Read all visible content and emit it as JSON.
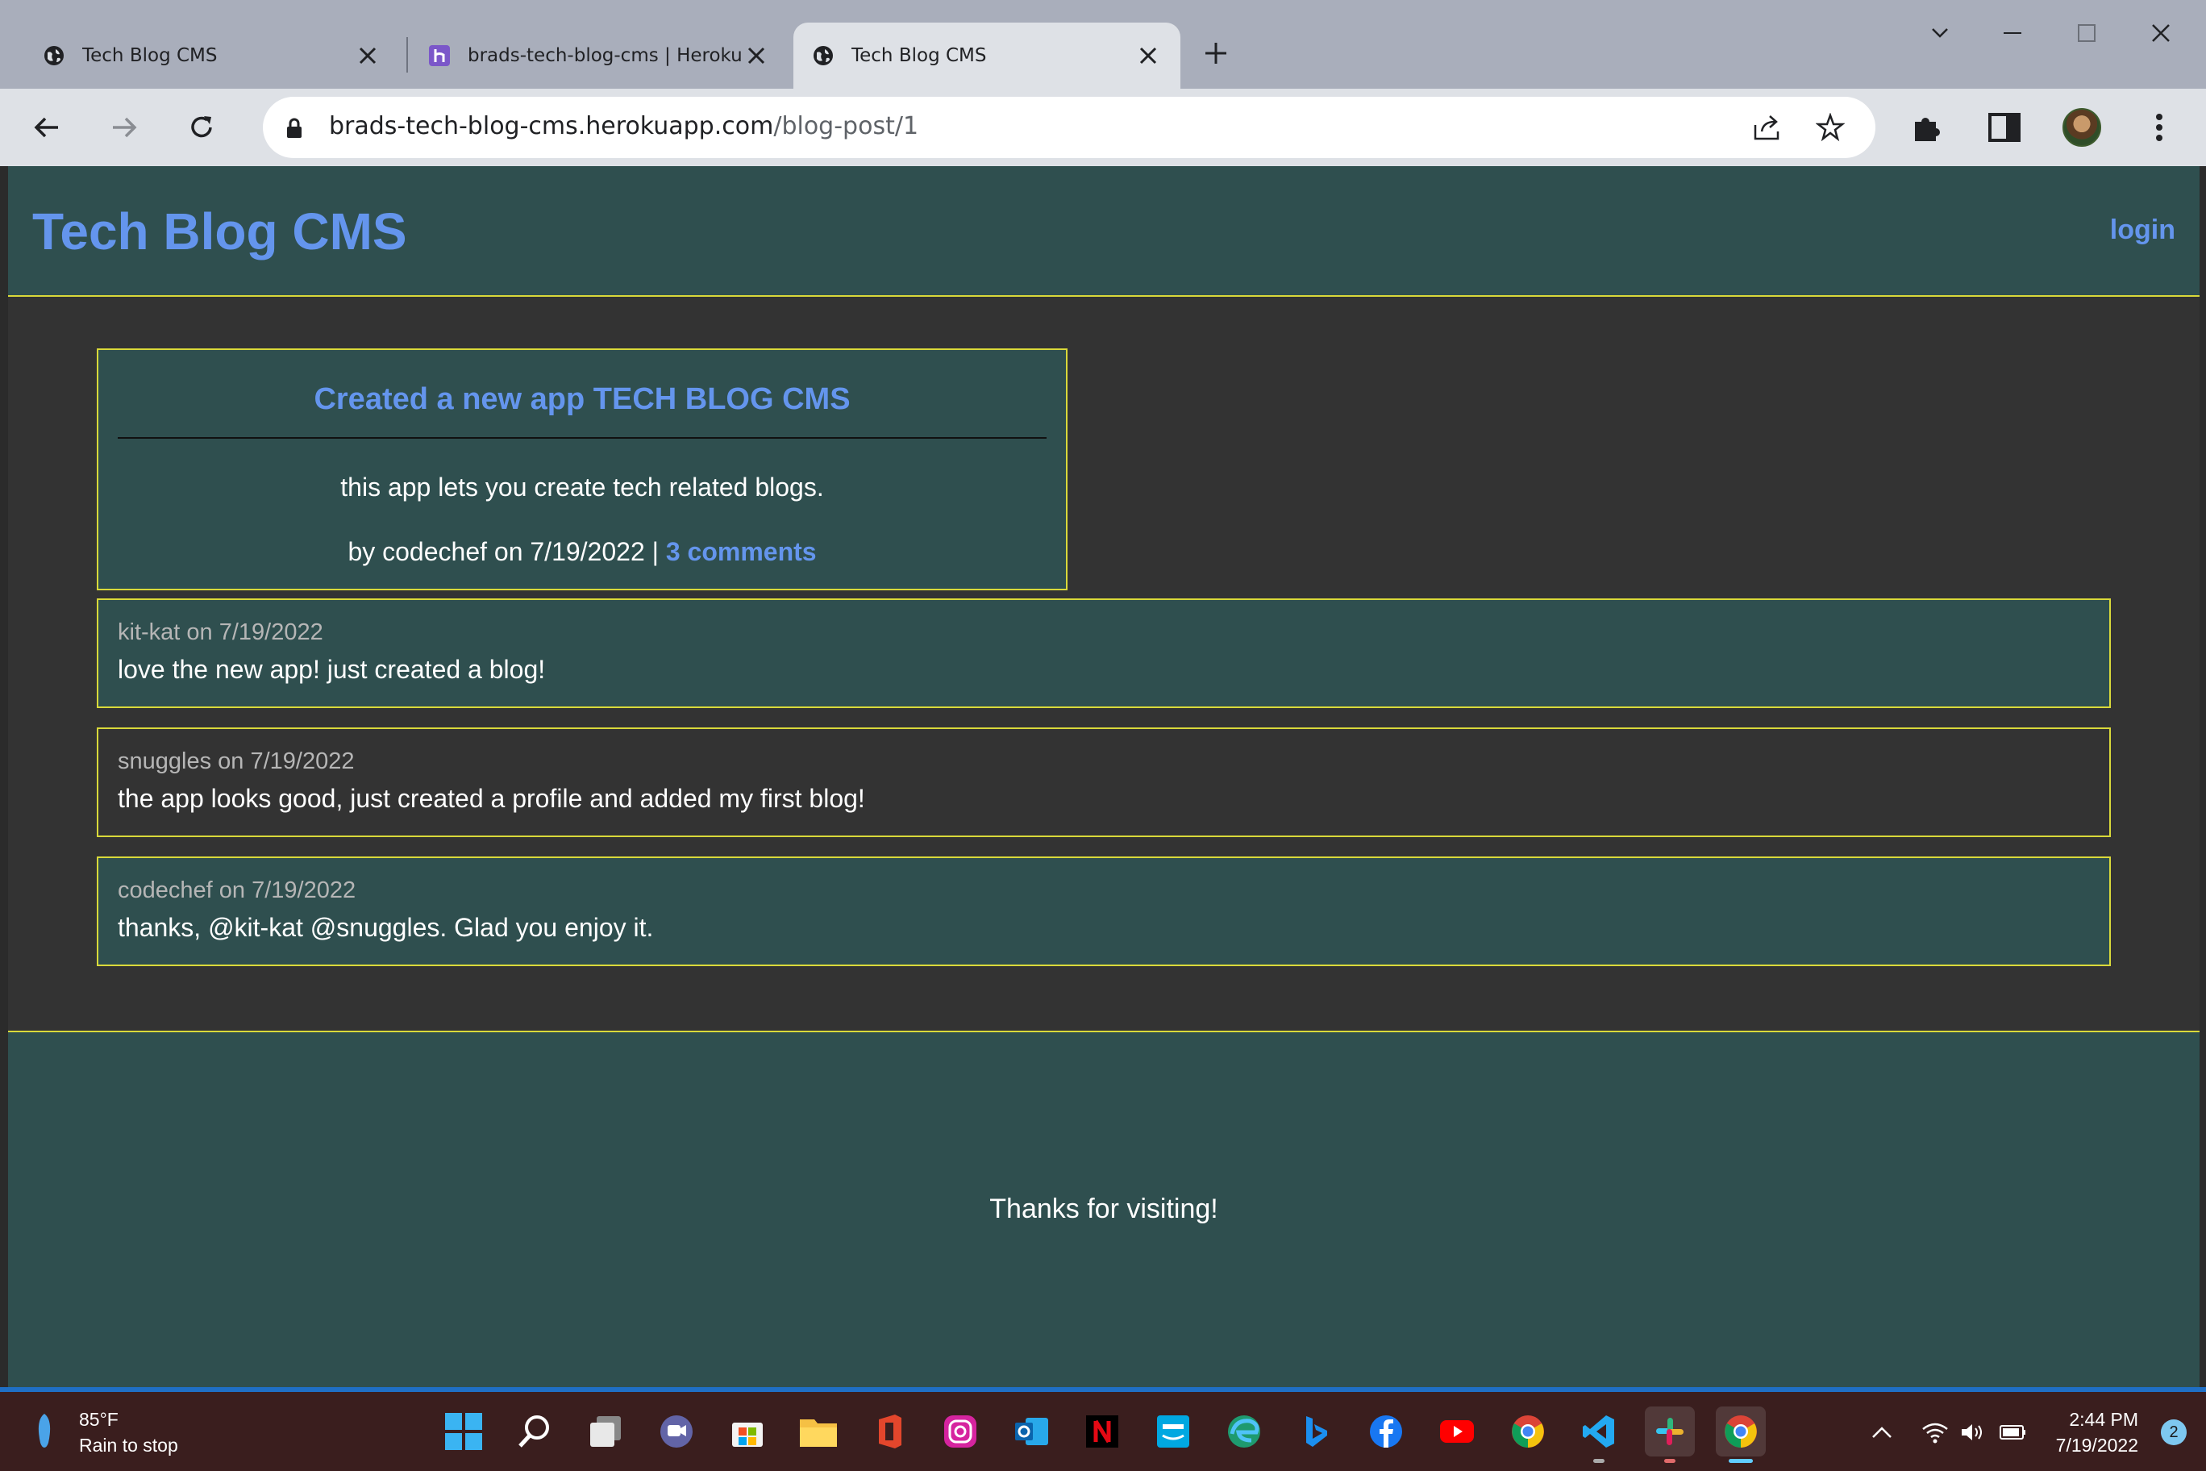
{
  "browser": {
    "tabs": [
      {
        "title": "Tech Blog CMS",
        "icon": "globe-icon"
      },
      {
        "title": "brads-tech-blog-cms | Heroku",
        "icon": "heroku-icon"
      },
      {
        "title": "Tech Blog CMS",
        "icon": "globe-icon",
        "active": true
      }
    ],
    "url_host": "brads-tech-blog-cms.herokuapp.com",
    "url_path": "/blog-post/1"
  },
  "site": {
    "title": "Tech Blog CMS",
    "login": "login",
    "accent": "#6495ed",
    "header_bg": "#2f4f4f",
    "border": "#d9d93a"
  },
  "post": {
    "title": "Created a new app TECH BLOG CMS",
    "body": "this app lets you create tech related blogs.",
    "meta": "by codechef on 7/19/2022 | ",
    "comments_link": "3 comments"
  },
  "comments": [
    {
      "meta": "kit-kat on 7/19/2022",
      "text": "love the new app! just created a blog!"
    },
    {
      "meta": "snuggles on 7/19/2022",
      "text": "the app looks good, just created a profile and added my first blog!"
    },
    {
      "meta": "codechef on 7/19/2022",
      "text": "thanks, @kit-kat @snuggles. Glad you enjoy it."
    }
  ],
  "footer": {
    "text": "Thanks for visiting!"
  },
  "taskbar": {
    "weather_temp": "85°F",
    "weather_desc": "Rain to stop",
    "time": "2:44 PM",
    "date": "7/19/2022",
    "notifications": "2",
    "apps": [
      "start-icon",
      "search-icon",
      "task-view-icon",
      "teams-chat-icon",
      "store-icon",
      "file-explorer-icon",
      "office-icon",
      "instagram-icon",
      "outlook-icon",
      "netflix-icon",
      "prime-video-icon",
      "edge-icon",
      "bing-icon",
      "facebook-icon",
      "youtube-icon",
      "chrome-icon",
      "vscode-icon",
      "slack-icon",
      "chrome-active-icon"
    ]
  }
}
